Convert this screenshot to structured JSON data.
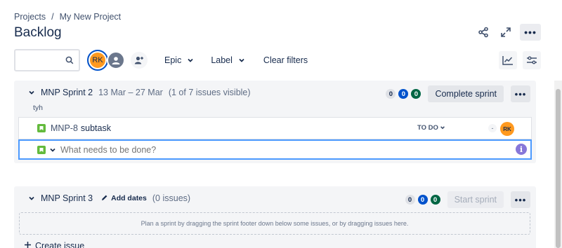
{
  "breadcrumb": {
    "projects": "Projects",
    "separator": "/",
    "project": "My New Project"
  },
  "page": {
    "title": "Backlog"
  },
  "toolbar": {
    "search_placeholder": "",
    "avatar_initials": "RK",
    "epic_label": "Epic",
    "label_label": "Label",
    "clear_filters": "Clear filters"
  },
  "sprints": [
    {
      "name": "MNP Sprint 2",
      "dates": "13 Mar – 27 Mar",
      "visibility": "(1 of 7 issues visible)",
      "goal": "tyh",
      "counts": {
        "todo": "0",
        "in_progress": "0",
        "done": "0"
      },
      "action": "Complete sprint",
      "issues": [
        {
          "key": "MNP-8",
          "summary": "subtask",
          "status": "TO DO",
          "estimate": "-",
          "assignee": "RK"
        }
      ],
      "create_placeholder": "What needs to be done?"
    },
    {
      "name": "MNP Sprint 3",
      "add_dates": "Add dates",
      "visibility": "(0 issues)",
      "counts": {
        "todo": "0",
        "in_progress": "0",
        "done": "0"
      },
      "action": "Start sprint",
      "empty_hint": "Plan a sprint by dragging the sprint footer down below some issues, or by dragging issues here.",
      "create_issue": "Create issue"
    }
  ],
  "icons": [
    "search-icon",
    "share-icon",
    "fullscreen-icon",
    "more-icon",
    "add-people-icon",
    "chevron-down-icon",
    "insights-icon",
    "settings-icon",
    "story-icon",
    "info-icon",
    "pencil-icon",
    "plus-icon"
  ],
  "colors": {
    "accent": "#0052cc",
    "story": "#63ba3c",
    "avatar": "#ff991f",
    "done": "#006644",
    "info": "#8777d9"
  }
}
